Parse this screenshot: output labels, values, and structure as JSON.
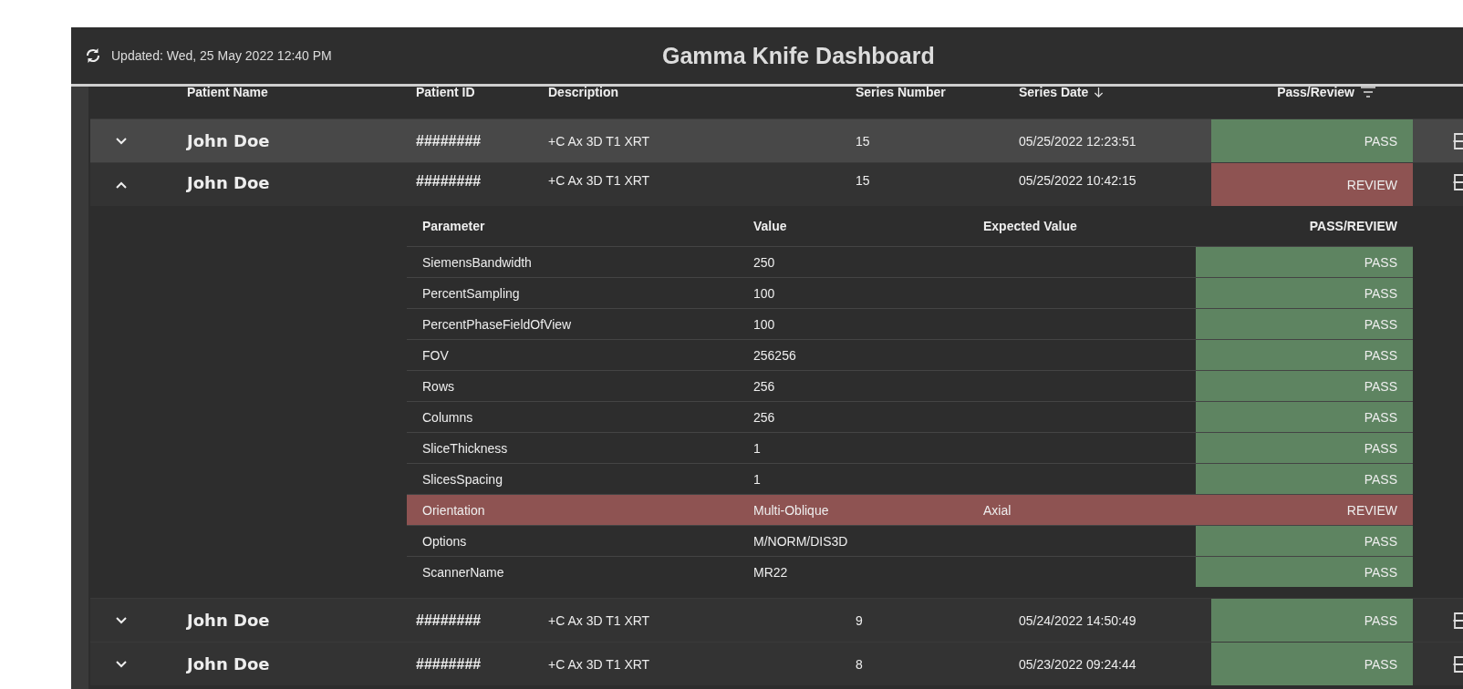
{
  "header": {
    "updated": "Updated: Wed, 25 May 2022 12:40 PM",
    "title": "Gamma Knife Dashboard"
  },
  "columns": [
    {
      "label": "Patient Name"
    },
    {
      "label": "Patient ID"
    },
    {
      "label": "Description"
    },
    {
      "label": "Series Number"
    },
    {
      "label": "Series Date",
      "sort_descending": true
    },
    {
      "label": "Pass/Review",
      "filter": true
    }
  ],
  "rows": [
    {
      "selected": true,
      "expanded": false,
      "name": "John Doe",
      "id": "########",
      "description": "+C Ax 3D T1 XRT",
      "series_number": "15",
      "series_date": "05/25/2022 12:23:51",
      "result": "PASS",
      "kind": "pass"
    },
    {
      "selected": false,
      "expanded": true,
      "name": "John Doe",
      "id": "########",
      "description": "+C Ax 3D T1 XRT",
      "series_number": "15",
      "series_date": "05/25/2022 10:42:15",
      "result": "REVIEW",
      "kind": "review",
      "details": {
        "columns": [
          "Parameter",
          "Value",
          "Expected Value",
          "PASS/REVIEW"
        ],
        "rows": [
          {
            "parameter": "SiemensBandwidth",
            "value": "250",
            "result": "PASS",
            "kind": "pass"
          },
          {
            "parameter": "PercentSampling",
            "value": "100",
            "result": "PASS",
            "kind": "pass"
          },
          {
            "parameter": "PercentPhaseFieldOfView",
            "value": "100",
            "result": "PASS",
            "kind": "pass"
          },
          {
            "parameter": "FOV",
            "value": "256256",
            "result": "PASS",
            "kind": "pass"
          },
          {
            "parameter": "Rows",
            "value": "256",
            "result": "PASS",
            "kind": "pass"
          },
          {
            "parameter": "Columns",
            "value": "256",
            "result": "PASS",
            "kind": "pass"
          },
          {
            "parameter": "SliceThickness",
            "value": "1",
            "result": "PASS",
            "kind": "pass"
          },
          {
            "parameter": "SlicesSpacing",
            "value": "1",
            "result": "PASS",
            "kind": "pass"
          },
          {
            "parameter": "Orientation",
            "value": "Multi-Oblique",
            "expected": "Axial",
            "result": "REVIEW",
            "kind": "review"
          },
          {
            "parameter": "Options",
            "value": "M/NORM/DIS3D",
            "result": "PASS",
            "kind": "pass"
          },
          {
            "parameter": "ScannerName",
            "value": "MR22",
            "result": "PASS",
            "kind": "pass"
          }
        ]
      }
    },
    {
      "selected": false,
      "expanded": false,
      "name": "John Doe",
      "id": "########",
      "description": "+C Ax 3D T1 XRT",
      "series_number": "9",
      "series_date": "05/24/2022 14:50:49",
      "result": "PASS",
      "kind": "pass"
    },
    {
      "selected": false,
      "expanded": false,
      "name": "John Doe",
      "id": "########",
      "description": "+C Ax 3D T1 XRT",
      "series_number": "8",
      "series_date": "05/23/2022 09:24:44",
      "result": "PASS",
      "kind": "pass"
    }
  ]
}
